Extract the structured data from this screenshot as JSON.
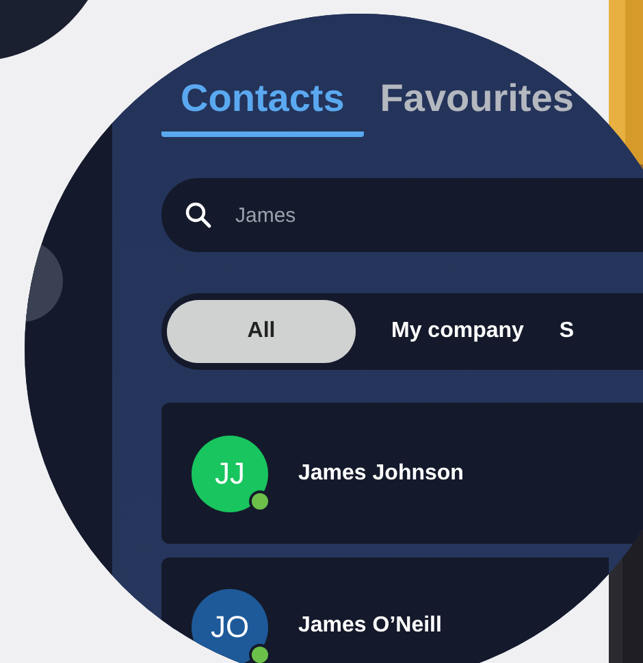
{
  "tabs": [
    {
      "label": "Contacts",
      "selected": true
    },
    {
      "label": "Favourites",
      "selected": false
    }
  ],
  "search": {
    "value": "James"
  },
  "filters": [
    {
      "label": "All",
      "selected": true
    },
    {
      "label": "My company",
      "selected": false
    },
    {
      "label": "S",
      "selected": false
    }
  ],
  "contacts": [
    {
      "initials": "JJ",
      "name": "James Johnson",
      "color": "#19c55e",
      "online": true
    },
    {
      "initials": "JO",
      "name": "James O’Neill",
      "color": "#1e5a9a",
      "online": true
    }
  ]
}
